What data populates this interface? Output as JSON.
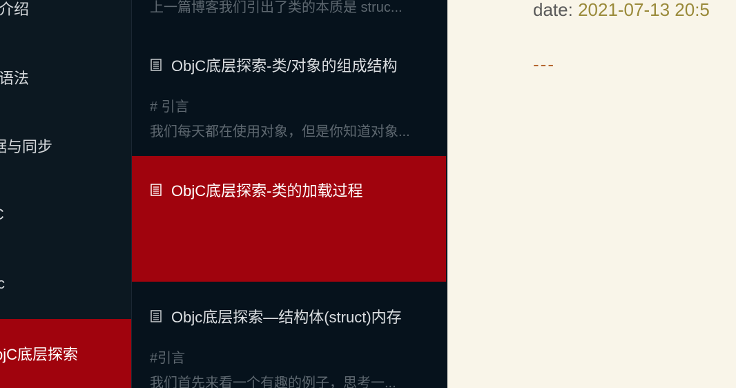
{
  "sidebar": {
    "items": [
      {
        "label": "能介绍"
      },
      {
        "label": "语法"
      },
      {
        "label": "据与同步"
      },
      {
        "label": "C"
      },
      {
        "label": "c"
      },
      {
        "label": "bjC底层探索",
        "active": true
      }
    ]
  },
  "notes": [
    {
      "title": "",
      "lines": [
        "上一篇博客我们引出了类的本质是 struc..."
      ]
    },
    {
      "title": "ObjC底层探索-类/对象的组成结构",
      "lines": [
        "# 引言",
        "我们每天都在使用对象，但是你知道对象..."
      ]
    },
    {
      "title": "ObjC底层探索-类的加载过程",
      "lines": [],
      "active": true
    },
    {
      "title": "Objc底层探索—结构体(struct)内存",
      "lines": [
        "#引言",
        "我们首先来看一个有趣的例子，思考一..."
      ]
    }
  ],
  "editor": {
    "date_key": "date:",
    "date_value": "2021-07-13 20:5",
    "separator": "---"
  },
  "colors": {
    "accent": "#a0030d",
    "sidebar_bg": "#0c1821",
    "list_bg": "#06121c",
    "editor_bg": "#f9f5e9"
  }
}
